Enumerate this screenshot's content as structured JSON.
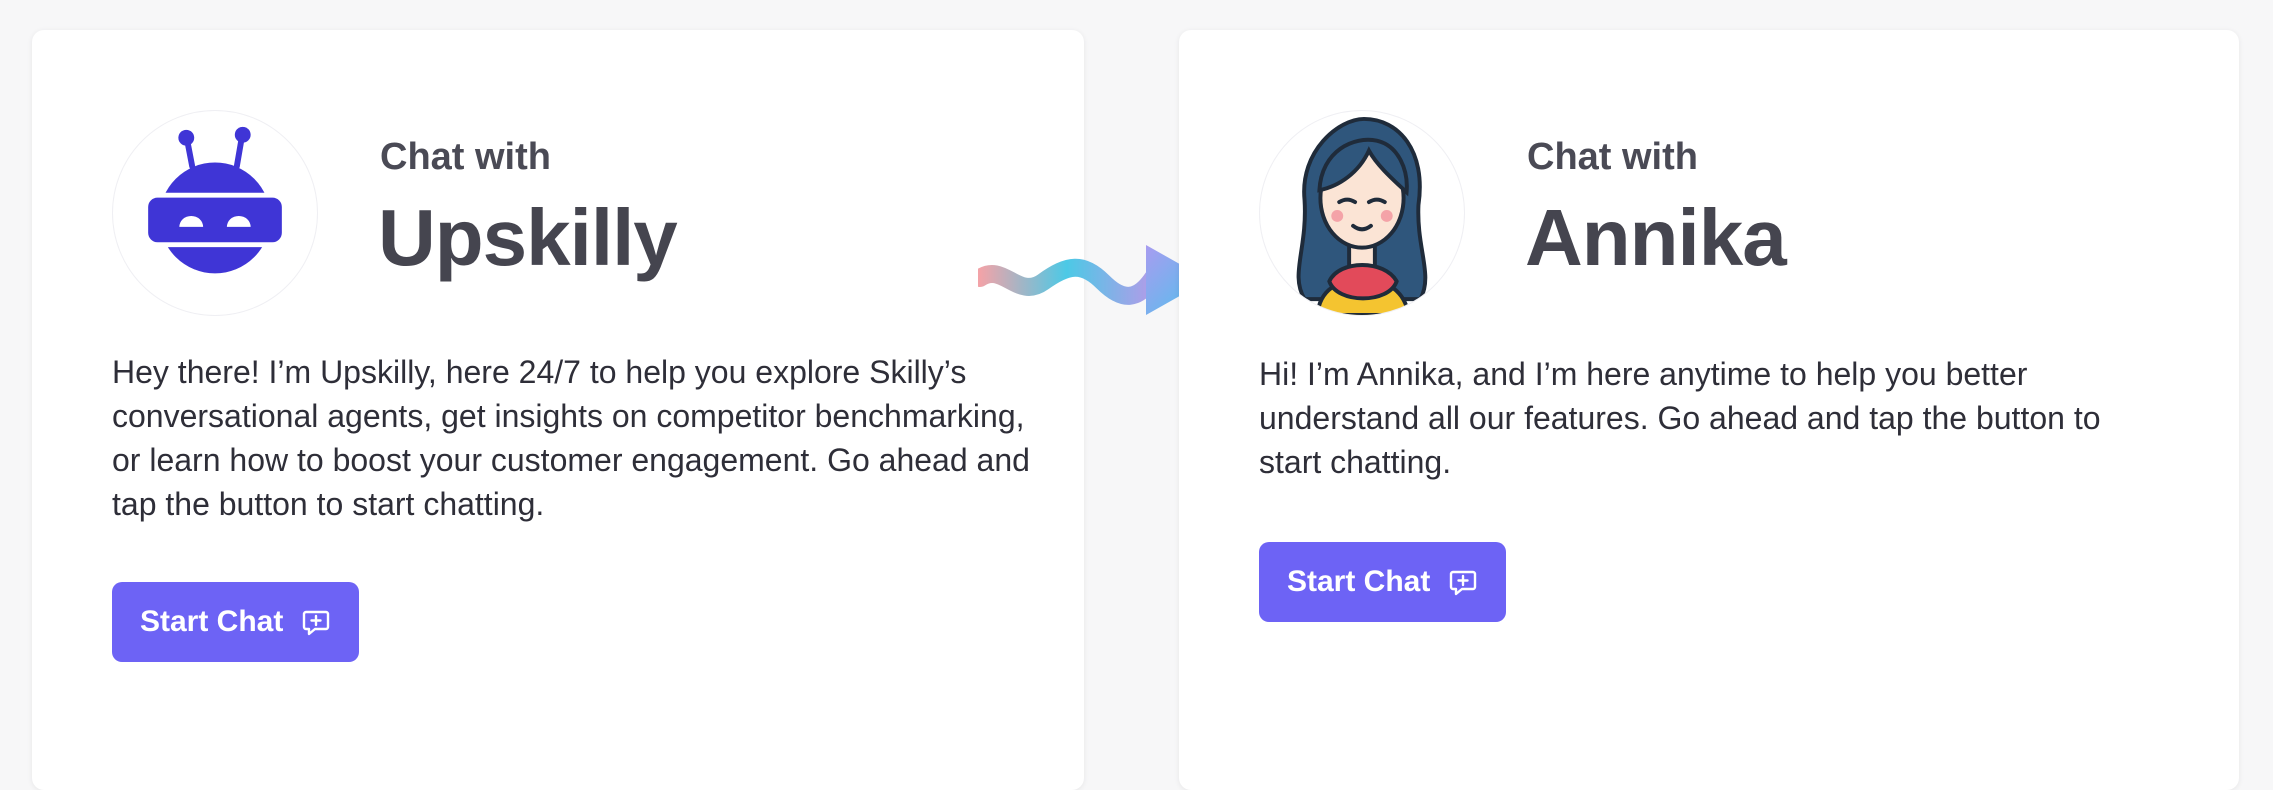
{
  "cards": [
    {
      "chat_with": "Chat with",
      "name": "Upskilly",
      "description": "Hey there! I’m Upskilly, here 24/7 to help you explore Skilly’s conversational agents, get insights on competitor benchmarking, or learn how to boost your customer engagement. Go ahead and tap the button to start chatting.",
      "button_label": "Start Chat",
      "avatar_icon": "robot-avatar"
    },
    {
      "chat_with": "Chat with",
      "name": "Annika",
      "description": "Hi! I’m Annika, and I’m here anytime to help you better understand all our features. Go ahead and tap the button to start chatting.",
      "button_label": "Start Chat",
      "avatar_icon": "woman-avatar"
    }
  ],
  "colors": {
    "accent": "#6d63f5",
    "robot": "#3f35d6",
    "text": "#45454f"
  },
  "connector_icon": "wavy-arrow-right-icon",
  "button_icon": "chat-plus-icon"
}
